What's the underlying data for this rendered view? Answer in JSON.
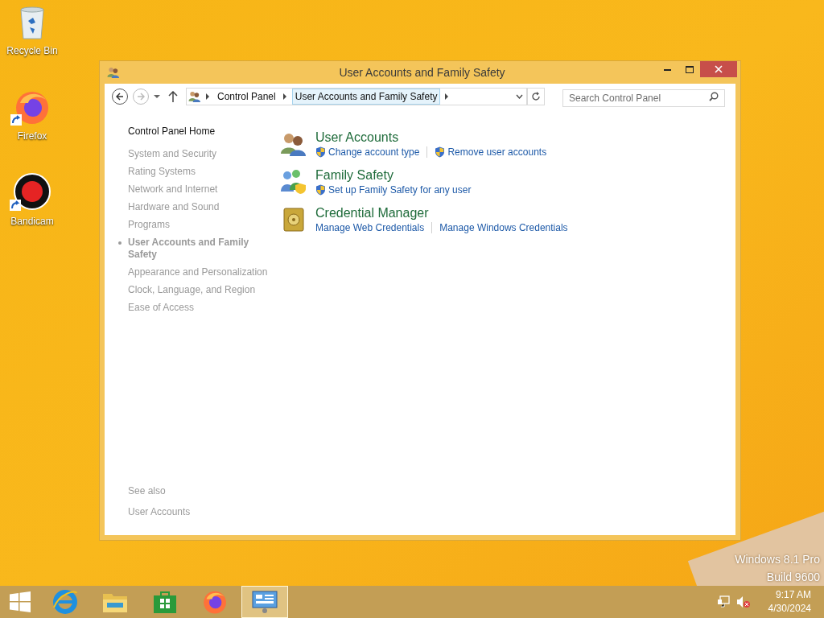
{
  "desktop_icons": [
    {
      "kind": "recycle",
      "label": "Recycle Bin",
      "shortcut": false
    },
    {
      "kind": "firefox",
      "label": "Firefox",
      "shortcut": true
    },
    {
      "kind": "bandicam",
      "label": "Bandicam",
      "shortcut": true
    }
  ],
  "window": {
    "title": "User Accounts and Family Safety"
  },
  "address_bar": {
    "crumbs": [
      {
        "label": "Control Panel",
        "selected": false
      },
      {
        "label": "User Accounts and Family Safety",
        "selected": true
      }
    ]
  },
  "search": {
    "placeholder": "Search Control Panel"
  },
  "sidebar": {
    "home": "Control Panel Home",
    "items": [
      {
        "label": "System and Security",
        "faded": true,
        "selected": false
      },
      {
        "label": "Rating Systems",
        "faded": true,
        "selected": false
      },
      {
        "label": "Network and Internet",
        "faded": true,
        "selected": false
      },
      {
        "label": "Hardware and Sound",
        "faded": true,
        "selected": false
      },
      {
        "label": "Programs",
        "faded": true,
        "selected": false
      },
      {
        "label": "User Accounts and Family Safety",
        "faded": true,
        "selected": true
      },
      {
        "label": "Appearance and Personalization",
        "faded": true,
        "selected": false
      },
      {
        "label": "Clock, Language, and Region",
        "faded": true,
        "selected": false
      },
      {
        "label": "Ease of Access",
        "faded": true,
        "selected": false
      }
    ],
    "see_also": {
      "heading": "See also",
      "links": [
        "User Accounts"
      ]
    }
  },
  "categories": [
    {
      "kind": "users",
      "title": "User Accounts",
      "links": [
        {
          "label": "Change account type",
          "shield": true
        },
        {
          "label": "Remove user accounts",
          "shield": true
        }
      ]
    },
    {
      "kind": "family",
      "title": "Family Safety",
      "links": [
        {
          "label": "Set up Family Safety for any user",
          "shield": true
        }
      ]
    },
    {
      "kind": "vault",
      "title": "Credential Manager",
      "links": [
        {
          "label": "Manage Web Credentials",
          "shield": false
        },
        {
          "label": "Manage Windows Credentials",
          "shield": false
        }
      ]
    }
  ],
  "watermark_text": [
    "Windows 8.1 Pro",
    "Build 9600"
  ],
  "taskbar": {
    "apps": [
      {
        "kind": "ie",
        "selected": false
      },
      {
        "kind": "explorer",
        "selected": false
      },
      {
        "kind": "store",
        "selected": false
      },
      {
        "kind": "firefox",
        "selected": false
      },
      {
        "kind": "control",
        "selected": true
      }
    ],
    "time": "9:17 AM",
    "date": "4/30/2024"
  }
}
